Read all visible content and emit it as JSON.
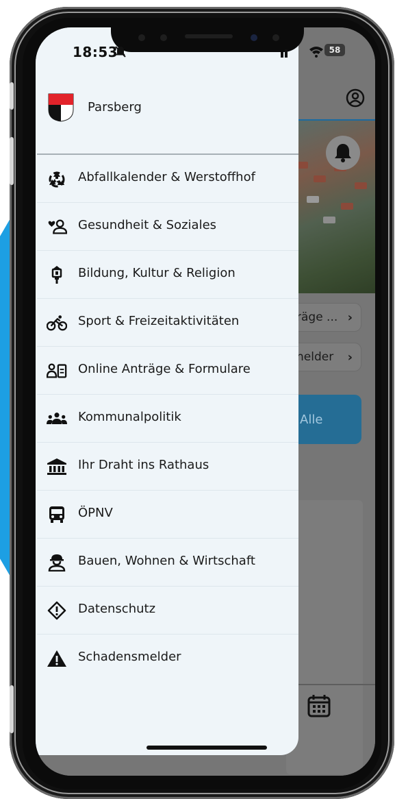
{
  "status_bar": {
    "time": "18:53",
    "battery": "58"
  },
  "header": {
    "town_name": "Parsberg"
  },
  "menu": [
    {
      "label": "Abfallkalender & Werstoffhof",
      "icon": "recycle-icon"
    },
    {
      "label": "Gesundheit & Soziales",
      "icon": "heart-person-icon"
    },
    {
      "label": "Bildung, Kultur & Religion",
      "icon": "lantern-icon"
    },
    {
      "label": "Sport & Freizeitaktivitäten",
      "icon": "bicycle-icon"
    },
    {
      "label": "Online Anträge & Formulare",
      "icon": "person-document-icon"
    },
    {
      "label": "Kommunalpolitik",
      "icon": "people-group-icon"
    },
    {
      "label": "Ihr Draht ins Rathaus",
      "icon": "town-hall-icon"
    },
    {
      "label": "ÖPNV",
      "icon": "bus-icon"
    },
    {
      "label": "Bauen, Wohnen & Wirtschaft",
      "icon": "construction-worker-icon"
    },
    {
      "label": "Datenschutz",
      "icon": "shield-alert-icon"
    },
    {
      "label": "Schadensmelder",
      "icon": "warning-icon"
    }
  ],
  "background_app": {
    "pill_1": "räge ...",
    "pill_2": "nelder",
    "alle_button": "Alle"
  },
  "colors": {
    "drawer_bg": "#eff5f9",
    "accent_blue": "#256d95",
    "edge_blue": "#1d9fe3",
    "crest_red": "#e2232a"
  }
}
